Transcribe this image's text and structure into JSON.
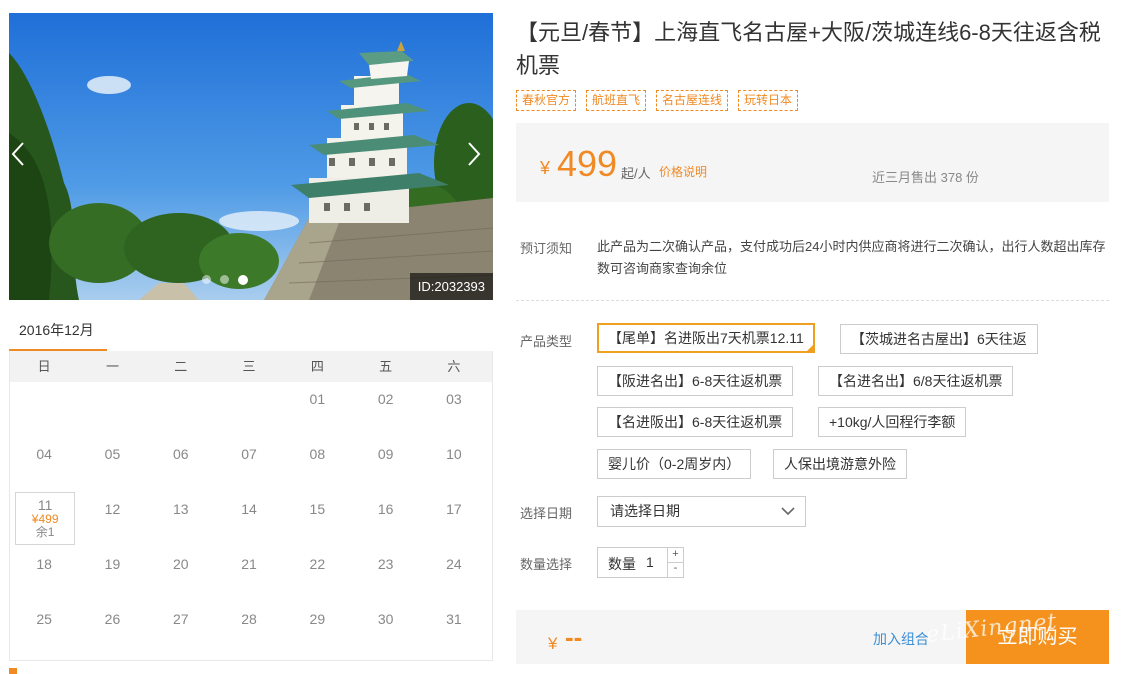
{
  "gallery": {
    "id_label": "ID:2032393",
    "dot_count": 3,
    "active_dot": 2
  },
  "calendar": {
    "month_tab": "2016年12月",
    "weekdays": [
      "日",
      "一",
      "二",
      "三",
      "四",
      "五",
      "六"
    ],
    "weeks": [
      [
        "",
        "",
        "",
        "",
        "01",
        "02",
        "03"
      ],
      [
        "04",
        "05",
        "06",
        "07",
        "08",
        "09",
        "10"
      ],
      [
        "11",
        "12",
        "13",
        "14",
        "15",
        "16",
        "17"
      ],
      [
        "18",
        "19",
        "20",
        "21",
        "22",
        "23",
        "24"
      ],
      [
        "25",
        "26",
        "27",
        "28",
        "29",
        "30",
        "31"
      ]
    ],
    "available": {
      "day": "11",
      "price": "¥499",
      "remain": "余1"
    }
  },
  "product": {
    "title": "【元旦/春节】上海直飞名古屋+大阪/茨城连线6-8天往返含税机票",
    "tags": [
      "春秋官方",
      "航班直飞",
      "名古屋连线",
      "玩转日本"
    ]
  },
  "price": {
    "currency": "¥",
    "amount": "499",
    "unit": "起/人",
    "explain_link": "价格说明",
    "sold": "近三月售出 378 份"
  },
  "notice": {
    "label": "预订须知",
    "text": "此产品为二次确认产品，支付成功后24小时内供应商将进行二次确认，出行人数超出库存数可咨询商家查询余位"
  },
  "options": {
    "label": "产品类型",
    "items": [
      "【尾单】名进阪出7天机票12.11",
      "【茨城进名古屋出】6天往返",
      "【阪进名出】6-8天往返机票",
      "【名进名出】6/8天往返机票",
      "【名进阪出】6-8天往返机票",
      "+10kg/人回程行李额",
      "婴儿价（0-2周岁内）",
      "人保出境游意外险"
    ],
    "selected_index": 0
  },
  "date_select": {
    "label": "选择日期",
    "value": "请选择日期"
  },
  "quantity": {
    "label": "数量选择",
    "inner_label": "数量",
    "value": "1",
    "plus": "+",
    "minus": "-"
  },
  "buy": {
    "currency": "¥",
    "total": "--",
    "add_combo": "加入组合",
    "buy_label": "立即购买"
  },
  "watermark": "eLiXingnet",
  "colors": {
    "accent": "#f08a24",
    "link": "#3b8fd6",
    "buy_button": "#f5921e"
  }
}
